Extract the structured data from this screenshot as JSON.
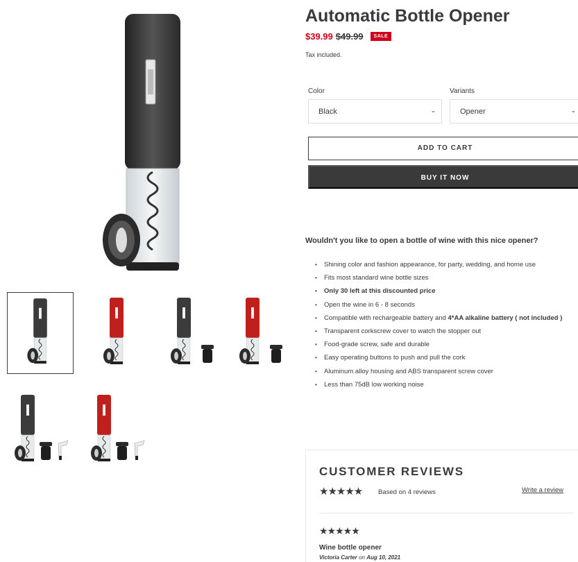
{
  "product": {
    "title": "Automatic Bottle Opener",
    "price_sale": "$39.99",
    "price_regular": "$49.99",
    "badge": "SALE",
    "tax_note": "Tax included."
  },
  "options": {
    "color_label": "Color",
    "color_value": "Black",
    "variants_label": "Variants",
    "variants_value": "Opener"
  },
  "buttons": {
    "add_to_cart": "ADD TO CART",
    "buy_now": "BUY IT NOW"
  },
  "description": {
    "heading": "Wouldn't you like to open a bottle of wine with this nice opener?",
    "bullets": [
      "Shining color and fashion appearance, for party, wedding, and home use",
      "Fits most standard wine bottle sizes",
      "Only 30 left at this discounted price",
      "Open the wine in 6 - 8 seconds",
      "Compatible with rechargeable battery and ",
      "Transparent corkscrew cover to watch the stopper out",
      "Food-grade screw, safe and durable",
      "Easy operating buttons to push and pull the cork",
      "Aluminum alloy housing and ABS transparent screw cover",
      "Less than 75dB low working noise"
    ],
    "bullet5_bold": "4*AA alkaline battery ( not included )"
  },
  "reviews": {
    "title": "CUSTOMER REVIEWS",
    "stars": "★★★★★",
    "based_on": "Based on 4 reviews",
    "write_review": "Write a review",
    "items": [
      {
        "stars": "★★★★★",
        "title": "Wine bottle opener",
        "author": "Victoria Carter",
        "on": "on",
        "date": "Aug 10, 2021"
      }
    ]
  },
  "gallery": {
    "thumbnails": [
      {
        "variant": "black",
        "with_cap": false,
        "with_pourer": false
      },
      {
        "variant": "red",
        "with_cap": false,
        "with_pourer": false
      },
      {
        "variant": "black",
        "with_cap": true,
        "with_pourer": false
      },
      {
        "variant": "red",
        "with_cap": true,
        "with_pourer": false
      },
      {
        "variant": "black",
        "with_cap": true,
        "with_pourer": true
      },
      {
        "variant": "red",
        "with_cap": true,
        "with_pourer": true
      }
    ],
    "colors": {
      "black": "#3b3b3b",
      "red": "#c0201d"
    }
  }
}
